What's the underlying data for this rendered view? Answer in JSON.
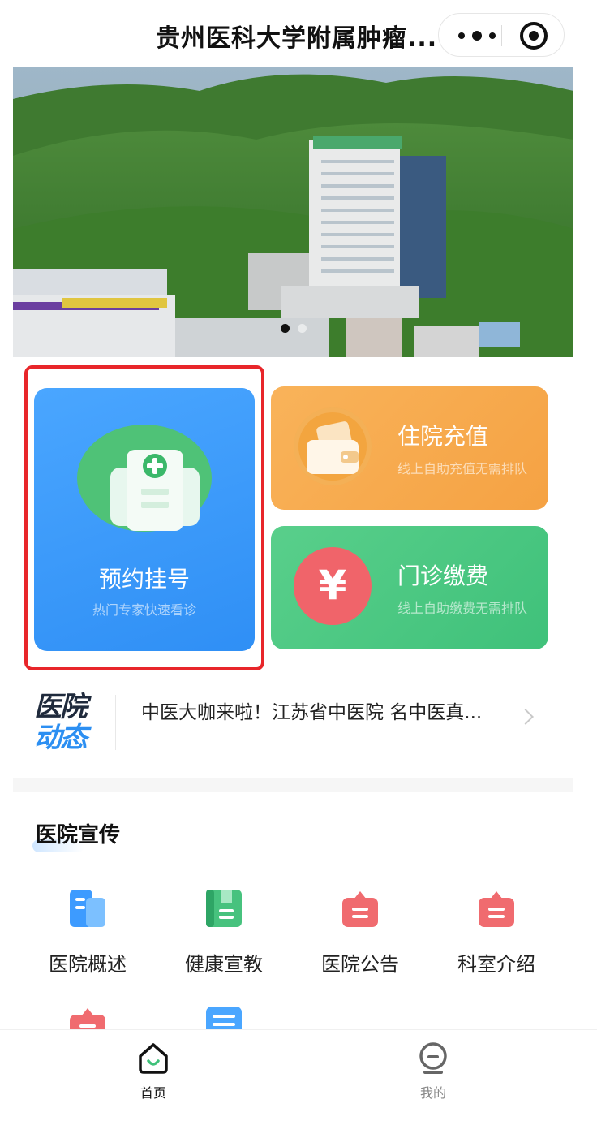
{
  "header": {
    "title": "贵州医科大学附属肿瘤...",
    "more_icon": "more-dots-icon",
    "close_icon": "target-circle-icon"
  },
  "banner": {
    "image": "hospital-aerial-photo",
    "slide_count": 2,
    "active_slide": 1
  },
  "services": {
    "appointment": {
      "label": "预约挂号",
      "sub": "热门专家快速看诊",
      "icon": "medical-record-icon",
      "highlighted": true
    },
    "recharge": {
      "label": "住院充值",
      "sub": "线上自助充值无需排队",
      "icon": "wallet-icon"
    },
    "payment": {
      "label": "门诊缴费",
      "sub": "线上自助缴费无需排队",
      "icon": "yen-icon",
      "symbol": "¥"
    }
  },
  "news": {
    "logo_line1": "医院",
    "logo_line2": "动态",
    "headline": "中医大咖来啦！江苏省中医院 名中医真...",
    "arrow_icon": "chevron-right-icon"
  },
  "promo": {
    "title": "医院宣传",
    "items": [
      {
        "label": "医院概述",
        "icon": "building-icon"
      },
      {
        "label": "健康宣教",
        "icon": "book-icon"
      },
      {
        "label": "医院公告",
        "icon": "clipboard-icon"
      },
      {
        "label": "科室介绍",
        "icon": "clipboard-icon"
      }
    ],
    "more_icons": [
      "clipboard-icon",
      "list-icon"
    ]
  },
  "tabbar": {
    "items": [
      {
        "label": "首页",
        "icon": "home-icon",
        "active": true
      },
      {
        "label": "我的",
        "icon": "profile-icon",
        "active": false
      }
    ]
  },
  "colors": {
    "primary_blue": "#2f8ff5",
    "orange": "#f5a243",
    "green": "#3fc17a",
    "highlight_red": "#e8262a",
    "tab_active": "#111111",
    "tab_inactive": "#888888"
  }
}
